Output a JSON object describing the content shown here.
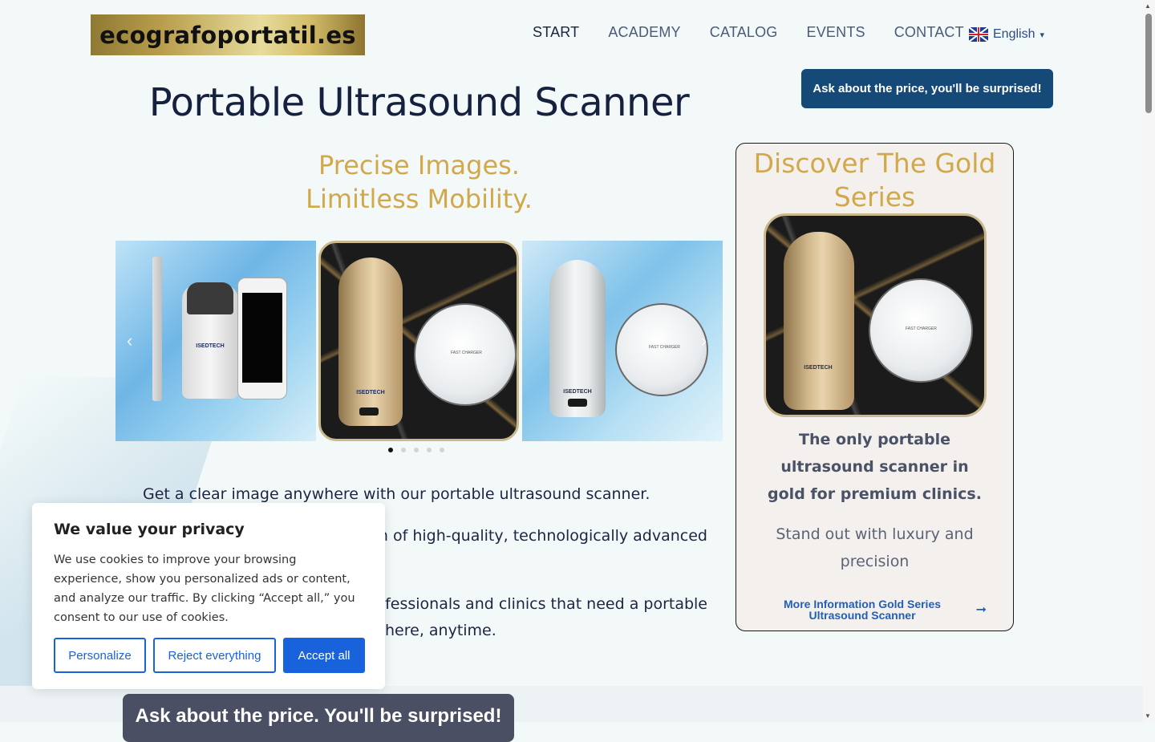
{
  "header": {
    "logo_text": "ecografoportatil.es",
    "nav": [
      {
        "label": "START",
        "active": true
      },
      {
        "label": "ACADEMY"
      },
      {
        "label": "CATALOG"
      },
      {
        "label": "EVENTS"
      },
      {
        "label": "CONTACT"
      }
    ],
    "language": {
      "label": "English",
      "caret": "▾",
      "flag_icon": "uk-flag-icon"
    }
  },
  "top_cta": "Ask about the price, you'll be surprised!",
  "hero": {
    "title": "Portable Ultrasound Scanner",
    "tagline_line1": "Precise Images.",
    "tagline_line2": "Limitless Mobility."
  },
  "carousel": {
    "slides": [
      {
        "brand": "ISEDTECH"
      },
      {
        "brand": "ISEDTECH",
        "charger_text": "FAST CHARGER"
      },
      {
        "brand": "ISEDTECH",
        "charger_text": "FAST CHARGER"
      }
    ],
    "prev_icon": "‹",
    "next_icon": "›",
    "dots": 5,
    "active_dot": 0
  },
  "body": {
    "p1": "Get a clear image anywhere with our portable ultrasound scanner.",
    "p2_fragment": "ection of high-quality, technologically advanced",
    "p3_fragment_line1": "re professionals and clinics that need a portable",
    "p3_fragment_line2": "here, anytime."
  },
  "bottom_cta": "Ask about the price. You'll be surprised!",
  "gold_card": {
    "title": "Discover The Gold Series",
    "description": "The only portable ultrasound scanner in gold for premium clinics.",
    "subtitle": "Stand out with luxury and precision",
    "link_label": "More Information Gold Series Ultrasound Scanner",
    "link_icon": "➞",
    "charger_text": "FAST CHARGER",
    "brand": "ISEDTECH"
  },
  "cookie_banner": {
    "title": "We value your privacy",
    "text": "We use cookies to improve your browsing experience, show you personalized ads or content, and analyze our traffic. By clicking “Accept all,” you consent to our use of cookies.",
    "buttons": {
      "personalize": "Personalize",
      "reject": "Reject everything",
      "accept": "Accept all"
    }
  },
  "colors": {
    "accent_gold": "#d1a84a",
    "cta_blue": "#154a78",
    "cookie_blue": "#1863dc",
    "background": "#f3f9f9"
  }
}
